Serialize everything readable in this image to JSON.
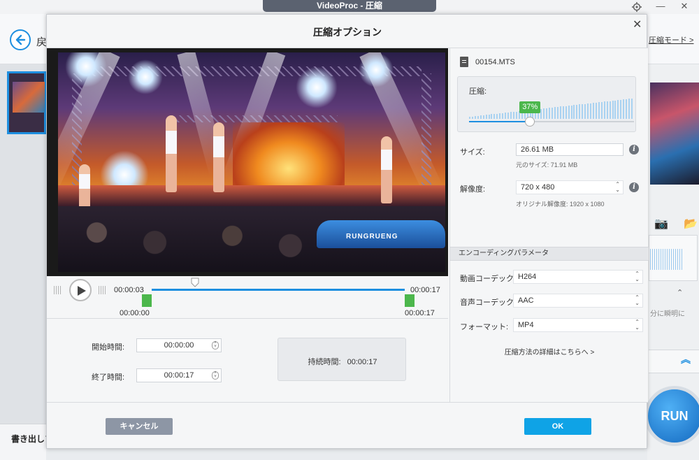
{
  "window": {
    "title": "VideoProc - 圧縮",
    "minimize": "—",
    "close": "✕"
  },
  "background": {
    "back_label": "戻",
    "header_link": "圧縮モード >",
    "export_label": "書き出しフ",
    "right_note": "分に瞬明に",
    "run_label": "RUN"
  },
  "dialog": {
    "title": "圧縮オプション",
    "close": "✕",
    "timeline": {
      "current_time": "00:00:03",
      "end_time": "00:00:17",
      "start_marker": "00:00:00",
      "end_marker": "00:00:17"
    },
    "start_label": "開始時間:",
    "start_value": "00:00:00",
    "end_label": "終了時間:",
    "end_value": "00:00:17",
    "duration_label": "持続時間:",
    "duration_value": "00:00:17",
    "cancel": "キャンセル",
    "ok": "OK"
  },
  "settings": {
    "file_name": "00154.MTS",
    "compress_label": "圧縮:",
    "compress_percent": "37%",
    "compress_value": 0.37,
    "size_label": "サイズ:",
    "size_value": "26.61  MB",
    "original_size": "元のサイズ: 71.91 MB",
    "resolution_label": "解像度:",
    "resolution_value": "720 x 480",
    "original_resolution": "オリジナル解像度:  1920 x 1080",
    "encoding_header": "エンコーディングパラメータ",
    "video_codec_label": "動画コーデック:",
    "video_codec_value": "H264",
    "audio_codec_label": "音声コーデック:",
    "audio_codec_value": "AAC",
    "format_label": "フォーマット:",
    "format_value": "MP4",
    "details_link": "圧縮方法の詳細はこちらへ >"
  },
  "icons": [
    "gear-icon",
    "minimize-icon",
    "close-icon",
    "back-arrow-icon",
    "file-icon",
    "info-icon",
    "play-icon",
    "camera-icon",
    "folder-icon",
    "chevron-up-icon"
  ],
  "colors": {
    "accent": "#1e8fe0",
    "ok": "#0fa3e6",
    "badge": "#4cb74c",
    "cancel": "#8d96a5"
  }
}
